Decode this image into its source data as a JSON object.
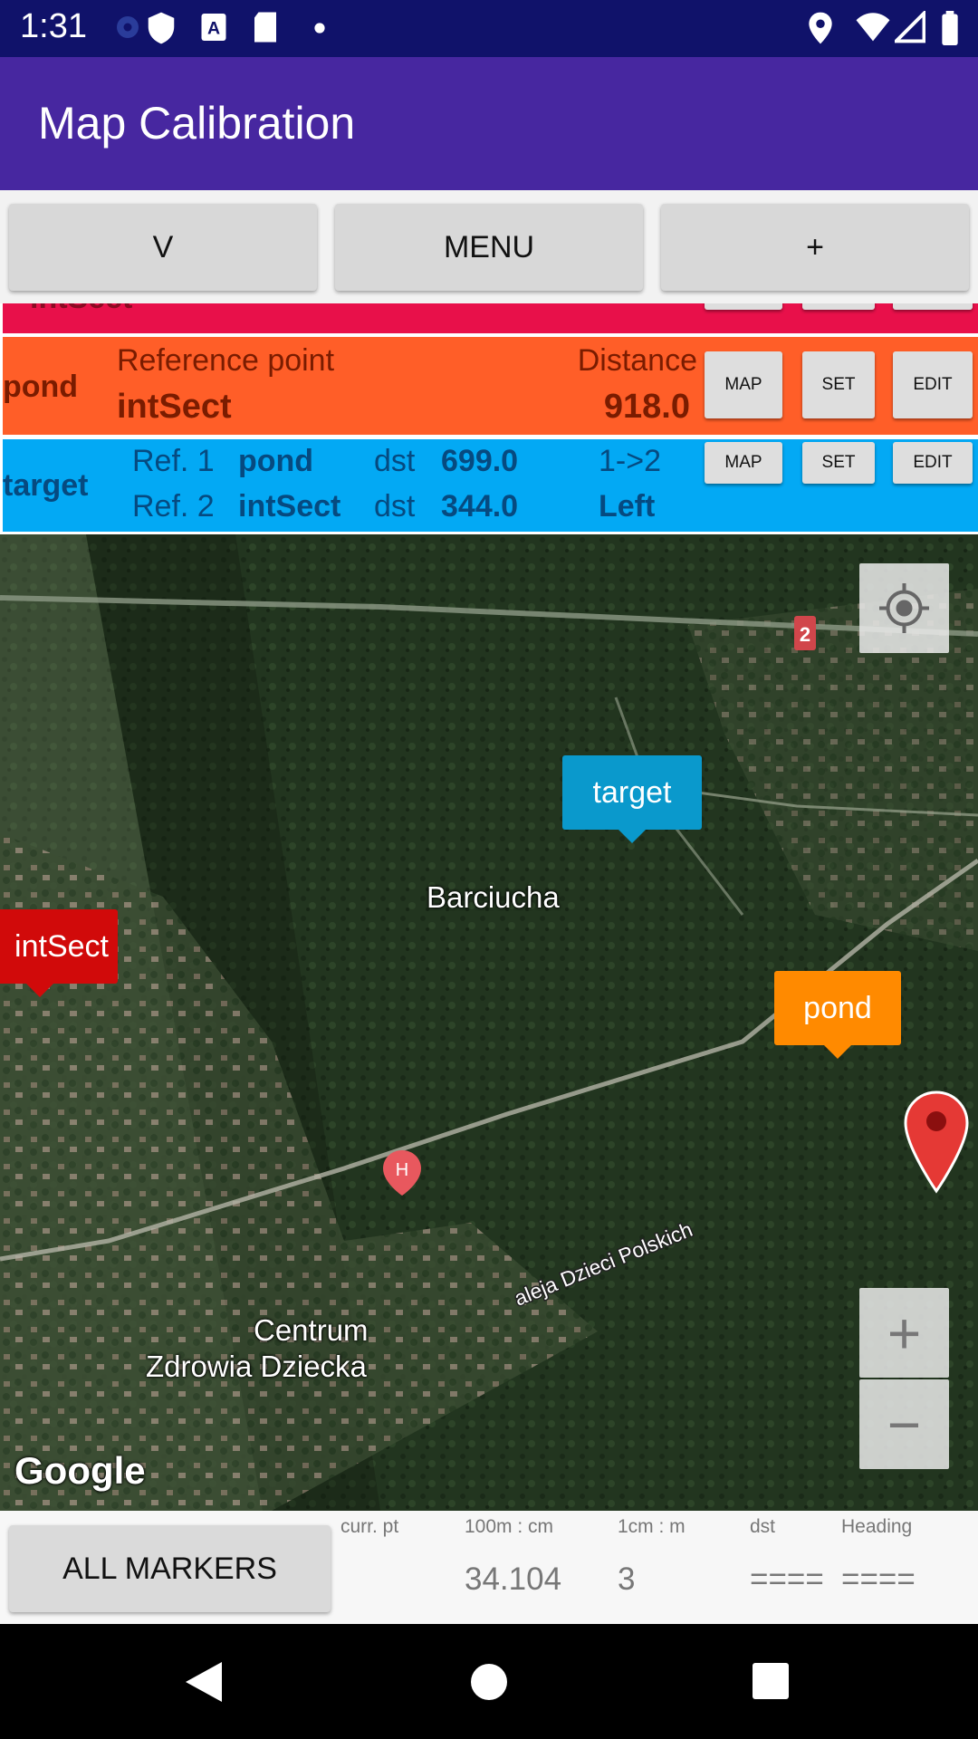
{
  "status_bar": {
    "time": "1:31"
  },
  "app_bar": {
    "title": "Map Calibration"
  },
  "toolbar": {
    "v_label": "V",
    "menu_label": "MENU",
    "add_label": "+"
  },
  "rows": [
    {
      "name": "intSect",
      "color": "#e8104a"
    },
    {
      "name": "pond",
      "color": "#ff5e28",
      "ref_label": "Reference point",
      "ref_value": "intSect",
      "distance_label": "Distance",
      "distance_value": "918.0",
      "map_btn": "MAP",
      "set_btn": "SET",
      "edit_btn": "EDIT"
    },
    {
      "name": "target",
      "color": "#03a9f4",
      "ref1_label": "Ref. 1",
      "ref1_value": "pond",
      "ref1_dst_label": "dst",
      "ref1_dst": "699.0",
      "ref2_label": "Ref. 2",
      "ref2_value": "intSect",
      "ref2_dst_label": "dst",
      "ref2_dst": "344.0",
      "direction_label": "1->2",
      "direction_value": "Left",
      "map_btn": "MAP",
      "set_btn": "SET",
      "edit_btn": "EDIT"
    }
  ],
  "map": {
    "markers": [
      {
        "label": "target",
        "color": "#0a99cc"
      },
      {
        "label": "intSect",
        "color": "#d10a0a"
      },
      {
        "label": "pond",
        "color": "#ff8a00"
      }
    ],
    "places": {
      "village": "Barciucha",
      "poi_line1": "Centrum",
      "poi_line2": "Zdrowia Dziecka",
      "street": "aleja Dzieci Polskich",
      "road_badge": "2"
    },
    "logo": "Google",
    "zoom_in": "+",
    "zoom_out": "−"
  },
  "bottom": {
    "all_markers_label": "ALL MARKERS",
    "columns": [
      {
        "label": "curr. pt",
        "value": ""
      },
      {
        "label": "100m : cm",
        "value": "34.104"
      },
      {
        "label": "1cm : m",
        "value": "3"
      },
      {
        "label": "dst",
        "value": "===="
      },
      {
        "label": "Heading",
        "value": "===="
      }
    ]
  }
}
